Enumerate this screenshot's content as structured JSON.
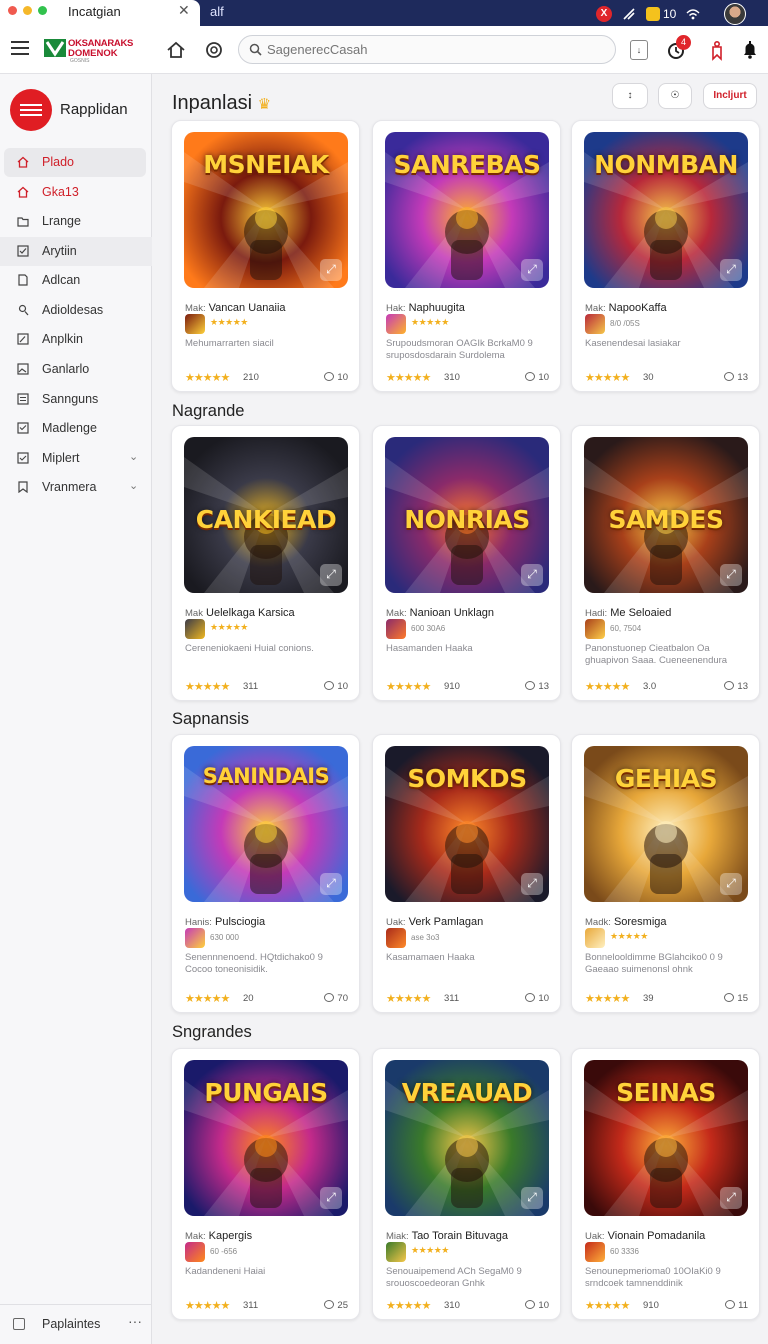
{
  "window": {
    "tab_title": "Incatgian",
    "tab_close": "✕",
    "titlebar_text": "alf",
    "status": {
      "badge_x": "X",
      "count": "10"
    }
  },
  "toolbar": {
    "logo_line1": "OKSANARAKS",
    "logo_line2": "DOMENOK",
    "logo_line3": "GOSNIS",
    "search_placeholder": "SagenerecCasah",
    "notif_count": "4",
    "sq_btn": "↓"
  },
  "sidebar": {
    "title": "Rapplidan",
    "items": [
      {
        "label": "Plado",
        "icon": "home-icon"
      },
      {
        "label": "Gka13",
        "icon": "home-outline-icon"
      },
      {
        "label": "Lrange",
        "icon": "folder-icon"
      },
      {
        "label": "Arytiin",
        "icon": "check-square-icon"
      },
      {
        "label": "Adlcan",
        "icon": "document-icon"
      },
      {
        "label": "Adioldesas",
        "icon": "user-icon"
      },
      {
        "label": "Anplkin",
        "icon": "edit-icon"
      },
      {
        "label": "Ganlarlo",
        "icon": "image-icon"
      },
      {
        "label": "Sannguns",
        "icon": "list-icon"
      },
      {
        "label": "Madlenge",
        "icon": "checklist-icon"
      },
      {
        "label": "Miplert",
        "icon": "checkbox-icon",
        "chevron": "⌄"
      },
      {
        "label": "Vranmera",
        "icon": "tag-icon",
        "chevron": "⌄"
      }
    ],
    "footer": {
      "label": "Paplaintes",
      "more": "···"
    }
  },
  "header_buttons": {
    "b1": "↕",
    "b2": "☉",
    "b3": "Incljurt"
  },
  "sections": [
    {
      "title": "Inpanlasi",
      "cards": [
        {
          "art": "MSNEIAK",
          "pre": "Mak:",
          "title": "Vancan Uanaiia",
          "mini_stars": "★★★★★",
          "desc": "Mehumarrarten siacil",
          "score": "210",
          "comments": "10",
          "colors": [
            "#ff7a1a",
            "#7a1a0e",
            "#ffd23a"
          ]
        },
        {
          "art": "SANREBAS",
          "pre": "Hak:",
          "title": "Naphuugita",
          "mini_stars": "★★★★★",
          "desc": "Srupoudsmoran OAGIk BcrkaM0 9 sruposdosdarain Surdolema",
          "score": "310",
          "comments": "10",
          "colors": [
            "#3a2a9a",
            "#c43ab8",
            "#ffb32a"
          ]
        },
        {
          "art": "NONMBAN",
          "pre": "Mak:",
          "title": "NapooKaffa",
          "mini_txt": "8/0 /05S",
          "desc": "Kasenendesai lasiakar",
          "score": "30",
          "comments": "13",
          "colors": [
            "#1d3a8a",
            "#b8283a",
            "#f6c84a"
          ]
        }
      ]
    },
    {
      "title": "Nagrande",
      "cards": [
        {
          "art": "CANKIEAD",
          "pre": "Mak",
          "title": "Uelelkaga Karsica",
          "mini_stars": "★★★★★",
          "desc": "Cereneniokaeni Huial conions.",
          "score": "311",
          "comments": "10",
          "colors": [
            "#1a1a20",
            "#3a3a48",
            "#f0b820"
          ]
        },
        {
          "art": "NONRIAS",
          "pre": "Mak:",
          "title": "Nanioan Unklagn",
          "mini_txt": "600 30A6",
          "desc": "Hasamanden Haaka",
          "score": "910",
          "comments": "13",
          "colors": [
            "#2a2a7a",
            "#8a2a6a",
            "#ff7a2a"
          ]
        },
        {
          "art": "SAMDES",
          "pre": "Hadi:",
          "title": "Me Seloaied",
          "mini_txt": "60, 7504",
          "desc": "Panonstuonep Cieatbalon Oa ghuapivon Saaa. Cueneenendura",
          "score": "3.0",
          "comments": "13",
          "colors": [
            "#2a1a1a",
            "#a8401a",
            "#ffd04a"
          ]
        }
      ]
    },
    {
      "title": "Sapnansis",
      "cards": [
        {
          "art": "SANINDAIS",
          "pre": "Hanis:",
          "title": "Pulsciogia",
          "mini_txt": "630 000",
          "desc": "Senennnenoend. HQtdichako0 9 Cocoo toneonisidik.",
          "score": "20",
          "comments": "70",
          "colors": [
            "#3a6ad8",
            "#c43ab8",
            "#ffd23a"
          ]
        },
        {
          "art": "SOMKDS",
          "pre": "Uak:",
          "title": "Verk Pamlagan",
          "mini_txt": "ase 3o3",
          "desc": "Kasamamaen Haaka",
          "score": "311",
          "comments": "10",
          "colors": [
            "#1a1a2a",
            "#a82a1a",
            "#ff8a2a"
          ]
        },
        {
          "art": "GEHIAS",
          "pre": "Madk:",
          "title": "Soresmiga",
          "mini_stars": "★★★★★",
          "desc": "Bonnelooldimme BGlahciko0 0 9 Gaeaao suimenonsl ohnk",
          "score": "39",
          "comments": "15",
          "colors": [
            "#7a4a1a",
            "#e8a83a",
            "#fff0c0"
          ]
        }
      ]
    },
    {
      "title": "Sngrandes",
      "cards": [
        {
          "art": "PUNGAIS",
          "pre": "Mak:",
          "title": "Kapergis",
          "mini_txt": "60 -656",
          "desc": "Kadandeneni Haiai",
          "score": "311",
          "comments": "25",
          "colors": [
            "#1a1a6a",
            "#c42a8a",
            "#ff8a1a"
          ]
        },
        {
          "art": "VREAUAD",
          "pre": "Miak:",
          "title": "Tao Torain Bituvaga",
          "mini_stars": "★★★★★",
          "desc": "Senouaipemend ACh SegaM0 9 srouoscoedeoran Gnhk",
          "score": "310",
          "comments": "10",
          "colors": [
            "#1a3a6a",
            "#3a7a2a",
            "#f6c84a"
          ]
        },
        {
          "art": "SEINAS",
          "pre": "Uak:",
          "title": "Vionain Pomadanila",
          "mini_txt": "60 3336",
          "desc": "Senounepmerioma0 10OIaKi0 9 srndcoek tamnenddinik",
          "score": "910",
          "comments": "11",
          "colors": [
            "#3a0a0a",
            "#c42a1a",
            "#ffb03a"
          ]
        }
      ]
    }
  ]
}
